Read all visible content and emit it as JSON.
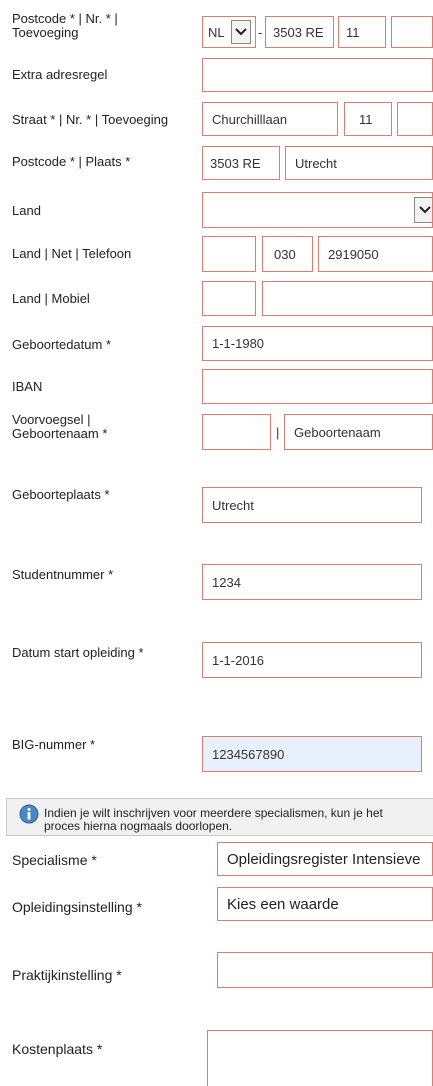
{
  "rows": {
    "postcode_nr": {
      "label": "Postcode * | Nr. * |\nToevoeging",
      "country_code": "NL",
      "separator": "-",
      "postcode": "3503 RE",
      "nr": "11",
      "toevoeging": ""
    },
    "extra_adres": {
      "label": "Extra adresregel",
      "value": ""
    },
    "straat": {
      "label": "Straat * | Nr. * | Toevoeging",
      "street": "Churchilllaan",
      "nr": "11",
      "toevoeging": ""
    },
    "postcode_plaats": {
      "label": "Postcode * | Plaats *",
      "postcode": "3503 RE",
      "plaats": "Utrecht"
    },
    "land": {
      "label": "Land",
      "value": ""
    },
    "telefoon": {
      "label": "Land | Net | Telefoon",
      "land": "",
      "net": "030",
      "nummer": "2919050"
    },
    "mobiel": {
      "label": "Land | Mobiel",
      "land": "",
      "nummer": ""
    },
    "geboortedatum": {
      "label": "Geboortedatum *",
      "value": "1-1-1980"
    },
    "iban": {
      "label": "IBAN",
      "value": ""
    },
    "geboortenaam": {
      "label": "Voorvoegsel |\nGeboortenaam *",
      "voorvoegsel": "",
      "separator": "|",
      "naam": "Geboortenaam"
    },
    "geboorteplaats": {
      "label": "Geboorteplaats *",
      "value": "Utrecht"
    },
    "studentnummer": {
      "label": "Studentnummer *",
      "value": "1234"
    },
    "datum_start": {
      "label": "Datum start opleiding *",
      "value": "1-1-2016"
    },
    "big": {
      "label": "BIG-nummer *",
      "value": "1234567890"
    },
    "specialisme": {
      "label": "Specialisme *",
      "value": "Opleidingsregister Intensieve"
    },
    "opleidingsinstelling": {
      "label": "Opleidingsinstelling *",
      "value": "Kies een waarde"
    },
    "praktijkinstelling": {
      "label": "Praktijkinstelling *",
      "value": ""
    },
    "kostenplaats": {
      "label": "Kostenplaats *",
      "value": ""
    }
  },
  "notice": {
    "line1": "Indien je wilt inschrijven voor meerdere specialismen, kun je het",
    "line2": "proces hierna nogmaals doorlopen.",
    "icon": "info-icon"
  },
  "colors": {
    "field_border": "#e07b70",
    "highlight": "#e8f0fe",
    "notice_bg": "#f1f1f1"
  }
}
